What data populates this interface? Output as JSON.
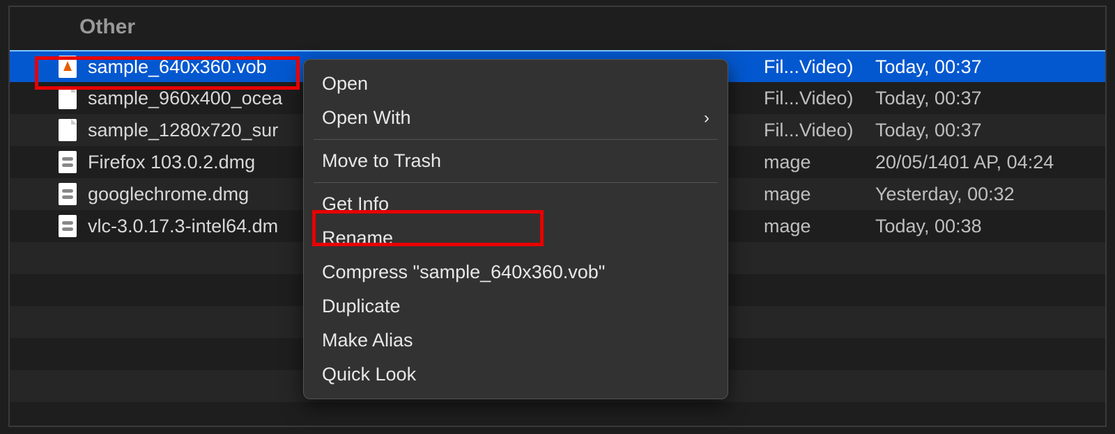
{
  "group_header": "Other",
  "files": [
    {
      "name": "sample_640x360.vob",
      "kind": "Fil...Video)",
      "date": "Today, 00:37",
      "icon": "vlc",
      "selected": true,
      "alt": false
    },
    {
      "name": "sample_960x400_ocea",
      "kind": "Fil...Video)",
      "date": "Today, 00:37",
      "icon": "generic",
      "selected": false,
      "alt": false
    },
    {
      "name": "sample_1280x720_sur",
      "kind": "Fil...Video)",
      "date": "Today, 00:37",
      "icon": "generic",
      "selected": false,
      "alt": true
    },
    {
      "name": "Firefox 103.0.2.dmg",
      "kind": "mage",
      "date": "20/05/1401 AP, 04:24",
      "icon": "dmg",
      "selected": false,
      "alt": false
    },
    {
      "name": "googlechrome.dmg",
      "kind": "mage",
      "date": "Yesterday, 00:32",
      "icon": "dmg",
      "selected": false,
      "alt": true
    },
    {
      "name": "vlc-3.0.17.3-intel64.dm",
      "kind": "mage",
      "date": "Today, 00:38",
      "icon": "dmg",
      "selected": false,
      "alt": false
    }
  ],
  "context_menu": {
    "open": "Open",
    "open_with": "Open With",
    "move_to_trash": "Move to Trash",
    "get_info": "Get Info",
    "rename": "Rename",
    "compress": "Compress \"sample_640x360.vob\"",
    "duplicate": "Duplicate",
    "make_alias": "Make Alias",
    "quick_look": "Quick Look"
  },
  "annotations": {
    "file_highlight": "selected-file-highlight",
    "menu_highlight": "get-info-highlight"
  }
}
